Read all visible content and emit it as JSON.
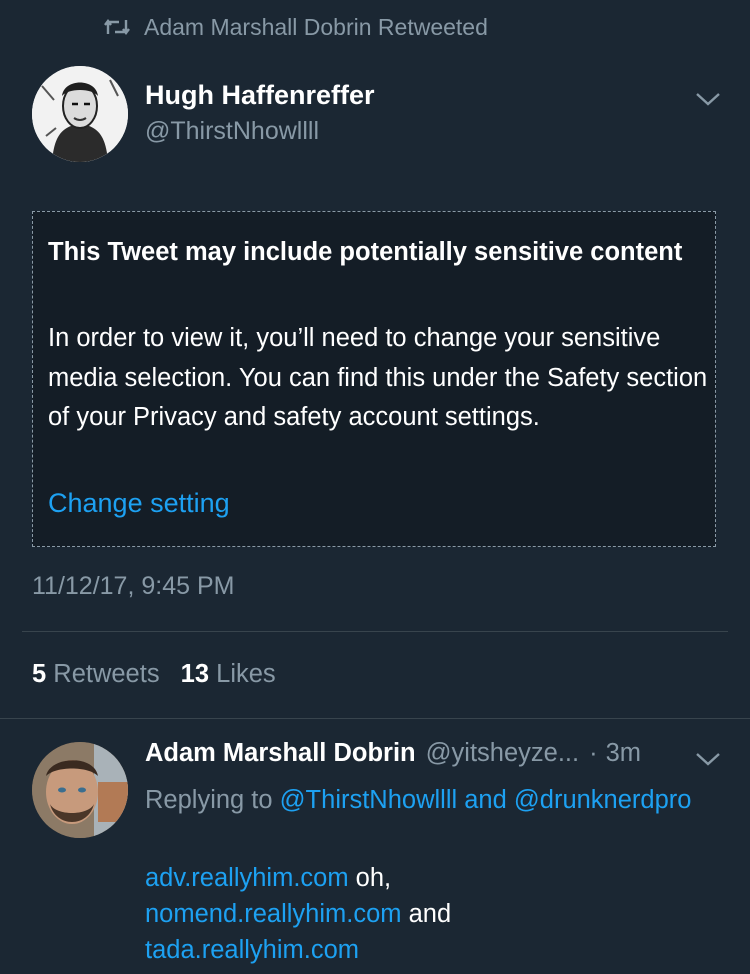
{
  "retweet_header": {
    "text": "Adam Marshall Dobrin Retweeted",
    "icon": "retweet-icon"
  },
  "tweet": {
    "author_name": "Hugh Haffenreffer",
    "author_handle": "@ThirstNhowllll",
    "menu_icon": "chevron-down-icon",
    "sensitive": {
      "title": "This Tweet may include potentially sensitive content",
      "body": "In order to view it, you’ll need to change your sensitive media selection. You can find this under the Safety section of your Privacy and safety account settings.",
      "link_label": "Change setting"
    },
    "timestamp": "11/12/17, 9:45 PM",
    "retweets_count": "5",
    "retweets_label": "Retweets",
    "likes_count": "13",
    "likes_label": "Likes"
  },
  "reply": {
    "author_name": "Adam Marshall Dobrin",
    "author_handle": "@yitsheyze...",
    "separator": "·",
    "time": "3m",
    "replying_prefix": "Replying to",
    "replying_users": "@ThirstNhowllll and @drunknerdpro",
    "lines": [
      {
        "link": "adv.reallyhim.com",
        "text": " oh,"
      },
      {
        "link": "nomend.reallyhim.com",
        "text": " and"
      },
      {
        "link": "tada.reallyhim.com",
        "text": ""
      }
    ]
  },
  "colors": {
    "background": "#1b2733",
    "accent": "#1da1f2",
    "muted": "#8899a6",
    "box": "#141d26"
  }
}
